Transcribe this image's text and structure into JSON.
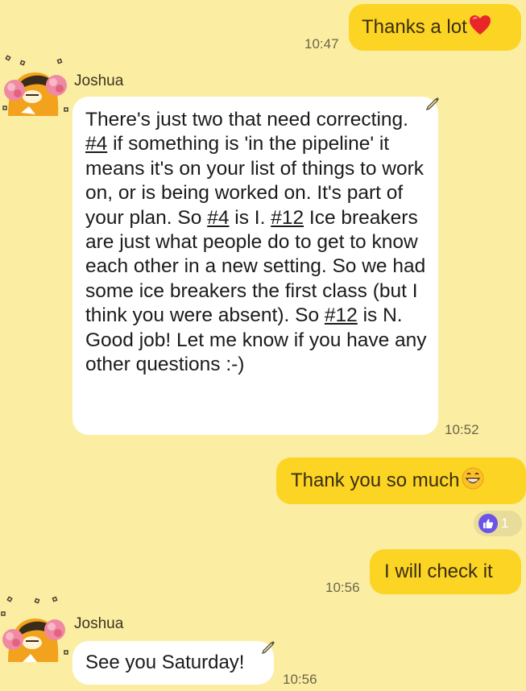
{
  "messages": [
    {
      "id": "m1",
      "from": "me",
      "text": "Thanks a lot",
      "emoji": "red-heart",
      "time": "10:47"
    },
    {
      "id": "m2",
      "from": "Joshua",
      "sender_name": "Joshua",
      "time": "10:52",
      "text_parts": [
        "There's just two that need correcting.  ",
        "#4",
        " if something is 'in the pipeline' it means it's on your list of things to work on, or is being worked on.  It's part of your plan.  So ",
        "#4",
        " is I.  ",
        "#12",
        " Ice breakers are just what people do to get to know each other in a new setting.  So we had some ice breakers the first class (but I think you were absent).  So ",
        "#12",
        " is N.   Good job!  Let me know if you have any other questions :-)"
      ]
    },
    {
      "id": "m3",
      "from": "me",
      "text": "Thank you so much",
      "emoji": "grinning-face",
      "time": "",
      "reaction": {
        "icon": "thumbs-up",
        "count": "1"
      }
    },
    {
      "id": "m4",
      "from": "me",
      "text": "I will check it",
      "time": "10:56"
    },
    {
      "id": "m5",
      "from": "Joshua",
      "sender_name": "Joshua",
      "text": "See you Saturday!",
      "time": "10:56"
    }
  ]
}
